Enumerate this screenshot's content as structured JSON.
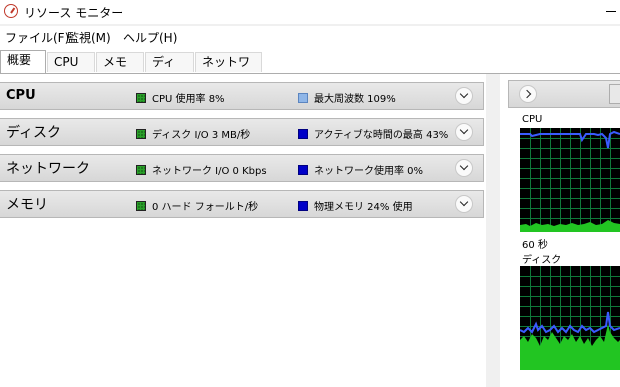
{
  "window": {
    "title": "リソース モニター"
  },
  "menu": [
    "ファイル(F)",
    "監視(M)",
    "ヘルプ(H)"
  ],
  "tabs": [
    "概要",
    "CPU",
    "メモリ",
    "ディスク",
    "ネットワーク"
  ],
  "active_tab": "概要",
  "sections": [
    {
      "name": "CPU",
      "metric1": "CPU 使用率 8%",
      "metric2": "最大周波数 109%"
    },
    {
      "name": "ディスク",
      "metric1": "ディスク I/O 3 MB/秒",
      "metric2": "アクティブな時間の最高 43%"
    },
    {
      "name": "ネットワーク",
      "metric1": "ネットワーク I/O 0 Kbps",
      "metric2": "ネットワーク使用率 0%"
    },
    {
      "name": "メモリ",
      "metric1": "0 ハード フォールト/秒",
      "metric2": "物理メモリ 24% 使用"
    }
  ],
  "graphs": {
    "cpu_label": "CPU",
    "time_label": "60 秒",
    "disk_label": "ディスク"
  },
  "colors": {
    "graph_background": "#000000",
    "graph_grid": "#0f7a3a",
    "graph_green": "#22c522",
    "graph_blue": "#3a5bff"
  },
  "icons": [
    "resource-monitor-icon",
    "minimize-icon",
    "chevron-down-icon",
    "chevron-right-icon"
  ]
}
